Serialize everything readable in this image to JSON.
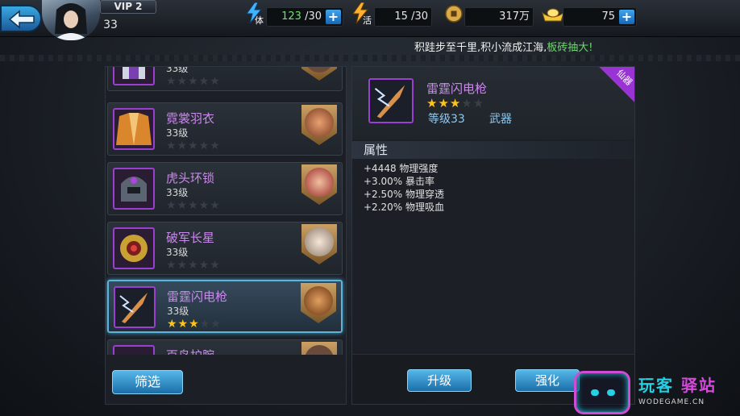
{
  "player": {
    "vip": "VIP 2",
    "level": "33"
  },
  "resources": {
    "stamina": {
      "label": "体",
      "current": "123",
      "max": " /30"
    },
    "energy": {
      "label": "活",
      "value": "15 /30"
    },
    "coins": {
      "value": "317万"
    },
    "ingots": {
      "value": "75"
    }
  },
  "ticker": {
    "text": "积跬步至千里,积小流成江海,",
    "highlight": "板砖抽大!"
  },
  "equipment_list": [
    {
      "name": "",
      "level": "33级",
      "stars": 0
    },
    {
      "name": "霓裳羽衣",
      "level": "33级",
      "stars": 0
    },
    {
      "name": "虎头环锁",
      "level": "33级",
      "stars": 0
    },
    {
      "name": "破军长星",
      "level": "33级",
      "stars": 0
    },
    {
      "name": "雷霆闪电枪",
      "level": "33级",
      "stars": 3,
      "selected": true
    },
    {
      "name": "百鸟护腕",
      "level": "",
      "stars": 0
    }
  ],
  "filter_label": "筛选",
  "detail": {
    "name": "雷霆闪电枪",
    "stars": 3,
    "max_stars": 5,
    "level": "等级33",
    "type": "武器",
    "corner_tag": "仙器",
    "attr_title": "属性",
    "attrs": [
      "+4448 物理强度",
      "+3.00% 暴击率",
      "+2.50% 物理穿透",
      "+2.20% 物理吸血"
    ],
    "upgrade_label": "升级",
    "enhance_label": "强化"
  },
  "watermark": {
    "brand_a": "玩客",
    "brand_b": "驿站",
    "domain": "WODEGAME.CN"
  },
  "colors": {
    "accent_blue": "#3fa5ea",
    "item_purple": "#c889ea",
    "star_gold": "#ffc21e",
    "green": "#6ee36e"
  }
}
